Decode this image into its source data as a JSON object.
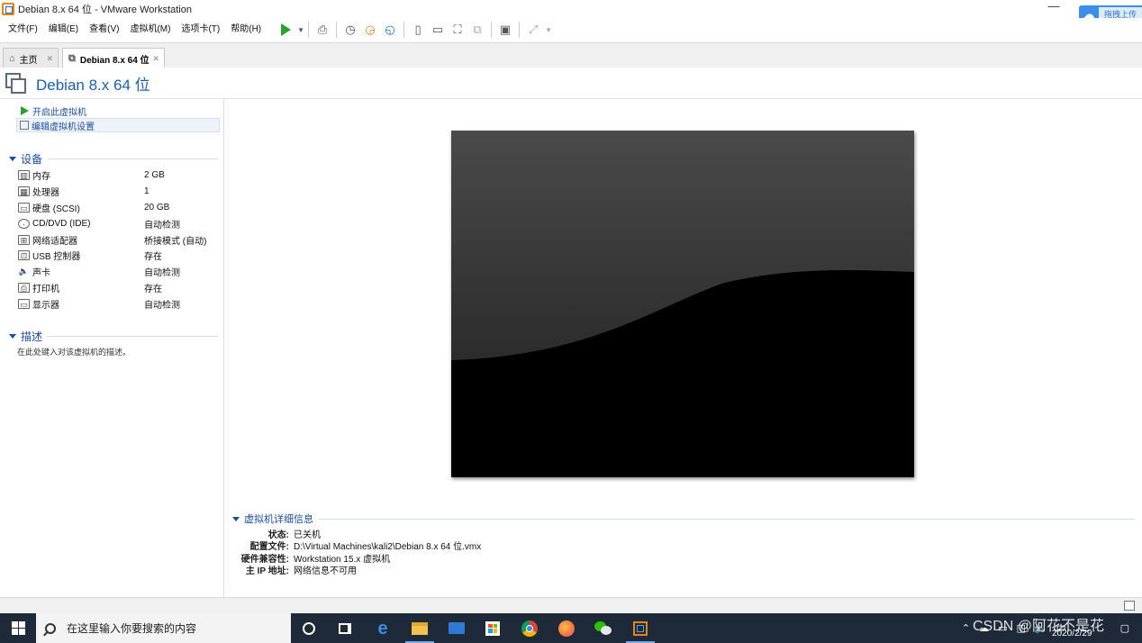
{
  "window": {
    "title": "Debian 8.x 64 位 - VMware Workstation",
    "minimize_glyph": "—"
  },
  "baidu_widget": {
    "label": "拖拽上传"
  },
  "menu": [
    "文件(F)",
    "编辑(E)",
    "查看(V)",
    "虚拟机(M)",
    "选项卡(T)",
    "帮助(H)"
  ],
  "tabs": [
    {
      "label": "主页",
      "icon": "home-icon"
    },
    {
      "label": "Debian 8.x 64 位",
      "icon": "vm-icon"
    }
  ],
  "vm": {
    "name": "Debian 8.x 64 位"
  },
  "actions": {
    "start": "开启此虚拟机",
    "edit": "编辑虚拟机设置"
  },
  "devices_section": "设备",
  "devices": [
    {
      "name": "内存",
      "value": "2 GB",
      "icon": "memory-icon"
    },
    {
      "name": "处理器",
      "value": "1",
      "icon": "processor-icon"
    },
    {
      "name": "硬盘 (SCSI)",
      "value": "20 GB",
      "icon": "hard-disk-icon"
    },
    {
      "name": "CD/DVD (IDE)",
      "value": "自动检测",
      "icon": "cd-dvd-icon"
    },
    {
      "name": "网络适配器",
      "value": "桥接模式 (自动)",
      "icon": "network-adapter-icon"
    },
    {
      "name": "USB 控制器",
      "value": "存在",
      "icon": "usb-controller-icon"
    },
    {
      "name": "声卡",
      "value": "自动检测",
      "icon": "sound-card-icon"
    },
    {
      "name": "打印机",
      "value": "存在",
      "icon": "printer-icon"
    },
    {
      "name": "显示器",
      "value": "自动检测",
      "icon": "display-icon"
    }
  ],
  "description_section": "描述",
  "description_placeholder": "在此处键入对该虚拟机的描述。",
  "details": {
    "title": "虚拟机详细信息",
    "rows": [
      {
        "key": "状态:",
        "value": "已关机"
      },
      {
        "key": "配置文件:",
        "value": "D:\\Virtual Machines\\kali2\\Debian 8.x 64 位.vmx"
      },
      {
        "key": "硬件兼容性:",
        "value": "Workstation 15.x 虚拟机"
      },
      {
        "key": "主 IP 地址:",
        "value": "网络信息不可用"
      }
    ]
  },
  "taskbar": {
    "search_placeholder": "在这里输入你要搜索的内容",
    "date": "2020/2/29",
    "watermark": "CSDN @阿花不是花",
    "apps": [
      "cortana-icon",
      "task-view-icon",
      "edge-icon",
      "file-explorer-icon",
      "mail-icon",
      "store-icon",
      "chrome-icon",
      "firefox-icon",
      "wechat-icon",
      "vmware-icon"
    ]
  },
  "colors": {
    "accent": "#1a5fb4",
    "play_green": "#2aa12a",
    "taskbar": "#1e2a3a"
  }
}
